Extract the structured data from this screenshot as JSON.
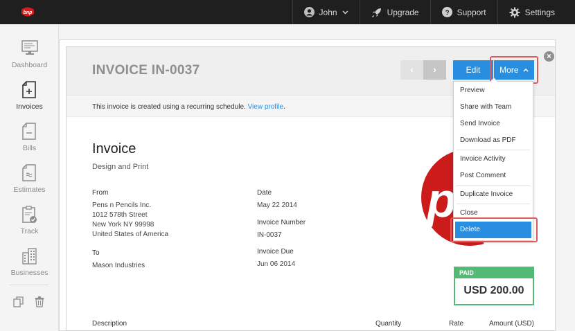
{
  "topbar": {
    "user_label": "John",
    "upgrade_label": "Upgrade",
    "support_label": "Support",
    "settings_label": "Settings"
  },
  "sidebar": {
    "items": [
      {
        "label": "Dashboard",
        "icon": "monitor-icon"
      },
      {
        "label": "Invoices",
        "icon": "invoice-icon",
        "active": true
      },
      {
        "label": "Bills",
        "icon": "bill-icon"
      },
      {
        "label": "Estimates",
        "icon": "estimate-icon"
      },
      {
        "label": "Track",
        "icon": "clipboard-icon"
      },
      {
        "label": "Businesses",
        "icon": "building-icon"
      }
    ]
  },
  "header": {
    "title": "INVOICE IN-0037",
    "prev_glyph": "‹",
    "next_glyph": "›",
    "edit_label": "Edit",
    "more_label": "More"
  },
  "notice": {
    "text": "This invoice is created using a recurring schedule.",
    "link": "View profile",
    "suffix": "."
  },
  "document": {
    "title": "Invoice",
    "subtitle": "Design and Print",
    "from_label": "From",
    "from_lines": [
      "Pens n Pencils Inc.",
      "1012 578th Street",
      "New York NY 99998",
      "United States of America"
    ],
    "to_label": "To",
    "to_name": "Mason Industries",
    "date_label": "Date",
    "date_value": "May 22 2014",
    "number_label": "Invoice Number",
    "number_value": "IN-0037",
    "due_label": "Invoice Due",
    "due_value": "Jun 06 2014"
  },
  "paid": {
    "status": "PAID",
    "amount": "USD 200.00"
  },
  "table": {
    "headers": [
      "Description",
      "Quantity",
      "Rate",
      "Amount (USD)"
    ]
  },
  "menu": {
    "items": [
      "Preview",
      "Share with Team",
      "Send Invoice",
      "Download as PDF",
      "Invoice Activity",
      "Post Comment",
      "Duplicate Invoice",
      "Close",
      "Delete"
    ]
  },
  "colors": {
    "accent": "#2a8ee0",
    "paid_green": "#52ba74",
    "highlight_red": "#e05a5a",
    "brand_red": "#cc1b1b"
  }
}
